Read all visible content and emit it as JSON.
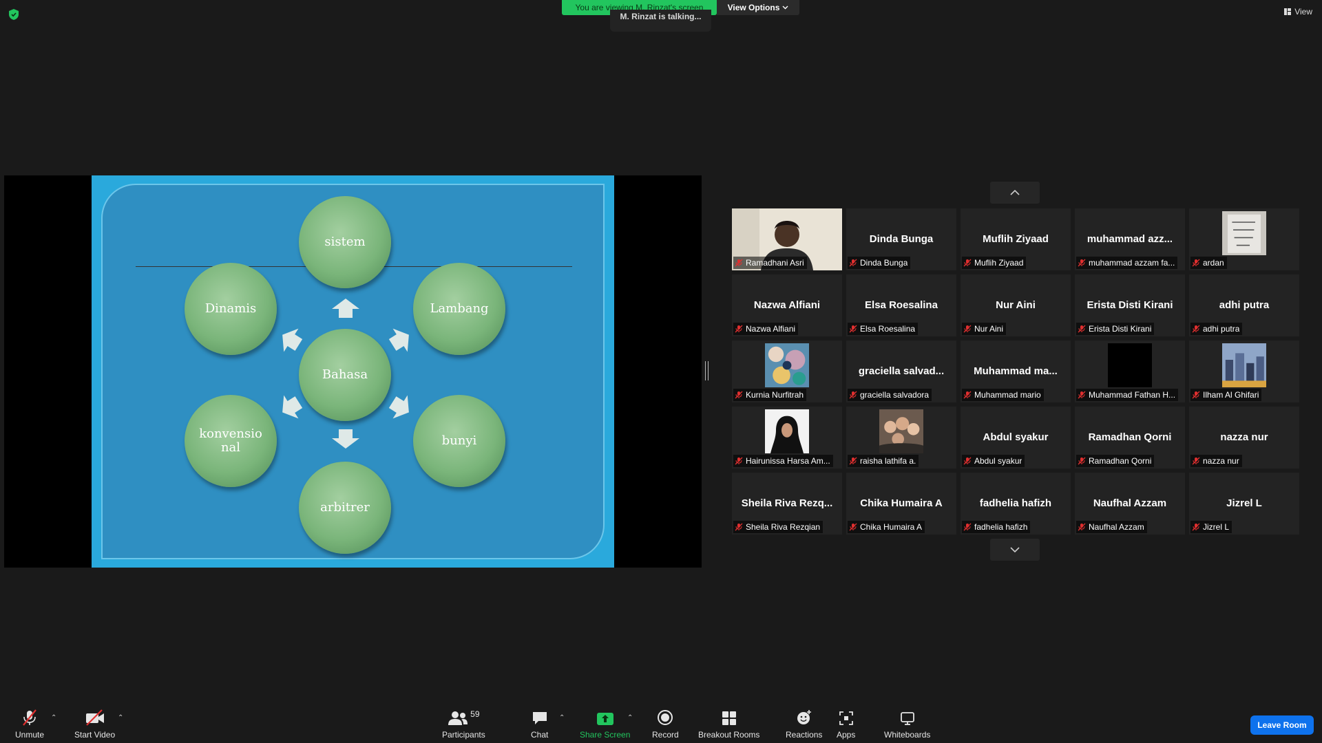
{
  "top": {
    "share_banner": "You are viewing M. Rinzat's screen",
    "view_options": "View Options",
    "talking": "M. Rinzat is talking...",
    "view": "View"
  },
  "slide": {
    "center": "Bahasa",
    "top": "sistem",
    "upper_left": "Dinamis",
    "upper_right": "Lambang",
    "lower_left": "konvensio\nnal",
    "lower_right": "bunyi",
    "bottom": "arbitrer"
  },
  "gallery": {
    "tiles": [
      {
        "display": "",
        "label": "Ramadhani Asri",
        "photo": "person"
      },
      {
        "display": "Dinda Bunga",
        "label": "Dinda Bunga"
      },
      {
        "display": "Muflih Ziyaad",
        "label": "Muflih Ziyaad"
      },
      {
        "display": "muhammad  azz...",
        "label": "muhammad azzam fa..."
      },
      {
        "display": "",
        "label": "ardan",
        "photo": "sign"
      },
      {
        "display": "Nazwa Alfiani",
        "label": "Nazwa Alfiani"
      },
      {
        "display": "Elsa Roesalina",
        "label": "Elsa Roesalina"
      },
      {
        "display": "Nur Aini",
        "label": "Nur Aini"
      },
      {
        "display": "Erista Disti Kirani",
        "label": "Erista Disti Kirani"
      },
      {
        "display": "adhi putra",
        "label": "adhi putra"
      },
      {
        "display": "",
        "label": "Kurnia Nurfitrah",
        "photo": "flowers"
      },
      {
        "display": "graciella  salvad...",
        "label": "graciella salvadora"
      },
      {
        "display": "Muhammad  ma...",
        "label": "Muhammad mario"
      },
      {
        "display": "",
        "label": "Muhammad Fathan H...",
        "photo": "black"
      },
      {
        "display": "",
        "label": "Ilham Al Ghifari",
        "photo": "city"
      },
      {
        "display": "",
        "label": "Hairunissa Harsa Am...",
        "photo": "hijab"
      },
      {
        "display": "",
        "label": "raisha lathifa a.",
        "photo": "group"
      },
      {
        "display": "Abdul syakur",
        "label": "Abdul syakur"
      },
      {
        "display": "Ramadhan Qorni",
        "label": "Ramadhan Qorni"
      },
      {
        "display": "nazza nur",
        "label": "nazza nur"
      },
      {
        "display": "Sheila  Riva  Rezq...",
        "label": "Sheila Riva Rezqian"
      },
      {
        "display": "Chika Humaira A",
        "label": "Chika Humaira A"
      },
      {
        "display": "fadhelia hafizh",
        "label": "fadhelia hafizh"
      },
      {
        "display": "Naufhal Azzam",
        "label": "Naufhal Azzam"
      },
      {
        "display": "Jizrel L",
        "label": "Jizrel L"
      }
    ]
  },
  "toolbar": {
    "unmute": "Unmute",
    "start_video": "Start Video",
    "participants": "Participants",
    "participants_count": "59",
    "chat": "Chat",
    "share_screen": "Share Screen",
    "record": "Record",
    "breakout": "Breakout Rooms",
    "reactions": "Reactions",
    "apps": "Apps",
    "whiteboards": "Whiteboards",
    "leave": "Leave Room"
  },
  "colors": {
    "share_green": "#22c55e",
    "leave_blue": "#0e72ed",
    "mute_red": "#e02f2f"
  }
}
